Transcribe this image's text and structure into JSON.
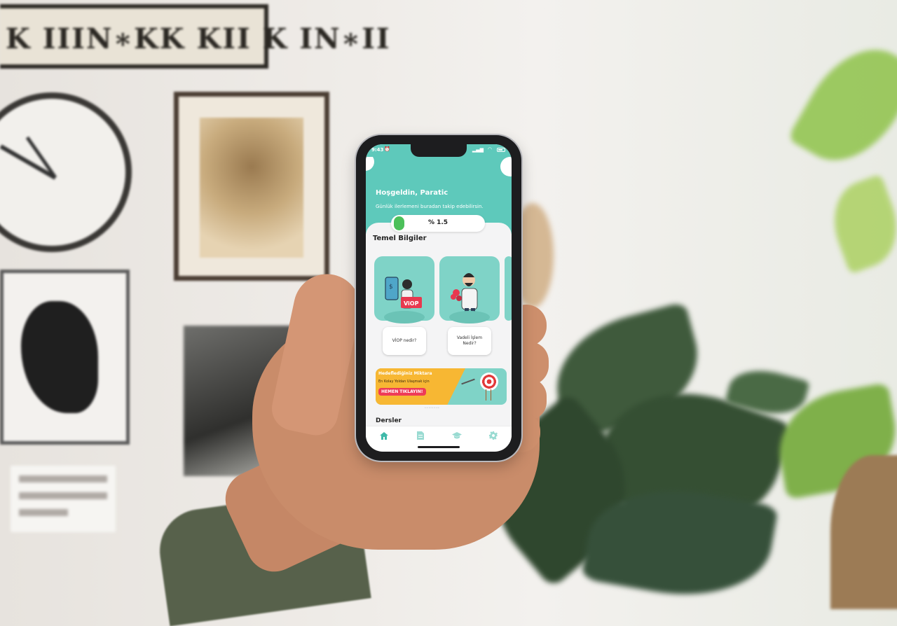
{
  "status_bar": {
    "time": "9:43",
    "signal_glyph": "▂▄▆",
    "wifi_glyph": "◠"
  },
  "header": {
    "greeting": "Hoşgeldin, Paratic",
    "subtitle": "Günlük ilerlemeni buradan takip edebilirsin.",
    "progress_label": "% 1.5",
    "progress_fraction": 0.12
  },
  "section_basics": {
    "title": "Temel Bilgiler",
    "cards": [
      {
        "illustration_text": "ViOP",
        "caption": "VİOP nedir?"
      },
      {
        "caption": "Vadeli İşlem Nedir?"
      }
    ]
  },
  "banner": {
    "line1": "Hedeflediğiniz Miktara",
    "line2": "En Kolay Yoldan Ulaşmak için",
    "cta": "HEMEN TIKLAYIN!"
  },
  "section_lessons": {
    "title": "Dersler"
  },
  "nav": {
    "items": [
      {
        "icon": "home-icon",
        "active": true
      },
      {
        "icon": "document-icon",
        "active": false
      },
      {
        "icon": "graduation-cap-icon",
        "active": false
      },
      {
        "icon": "gear-icon",
        "active": false
      }
    ],
    "active_color": "#3fb9a9",
    "inactive_color": "#9adbd2"
  },
  "colors": {
    "header_teal": "#5ec9bb",
    "card_teal": "#7fd3c7",
    "progress_green": "#4cc05a",
    "banner_orange": "#f7b733",
    "cta_red": "#ee3b57"
  }
}
